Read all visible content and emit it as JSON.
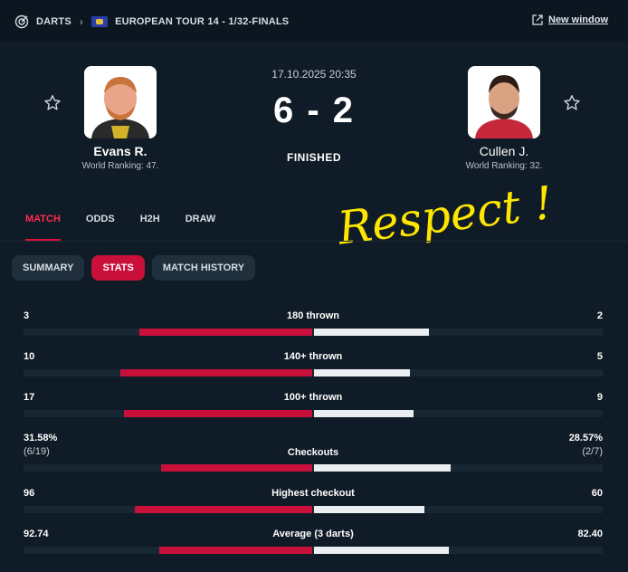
{
  "breadcrumb": {
    "sport": "DARTS",
    "tournament": "EUROPEAN TOUR 14 - 1/32-FINALS"
  },
  "new_window": "New window",
  "match": {
    "datetime": "17.10.2025 20:35",
    "score": "6 - 2",
    "status": "FINISHED"
  },
  "home": {
    "name": "Evans R.",
    "ranking": "World Ranking: 47."
  },
  "away": {
    "name": "Cullen J.",
    "ranking": "World Ranking: 32."
  },
  "tabs": [
    "MATCH",
    "ODDS",
    "H2H",
    "DRAW"
  ],
  "subtabs": [
    "SUMMARY",
    "STATS",
    "MATCH HISTORY"
  ],
  "annotation": "Respect !",
  "stats": [
    {
      "label": "180 thrown",
      "home": "3",
      "away": "2",
      "home_frac": 0.6,
      "away_frac": 0.4
    },
    {
      "label": "140+ thrown",
      "home": "10",
      "away": "5",
      "home_frac": 0.667,
      "away_frac": 0.333
    },
    {
      "label": "100+ thrown",
      "home": "17",
      "away": "9",
      "home_frac": 0.654,
      "away_frac": 0.346
    },
    {
      "label": "Checkouts",
      "home": "31.58%",
      "away": "28.57%",
      "home_sub": "(6/19)",
      "away_sub": "(2/7)",
      "home_frac": 0.525,
      "away_frac": 0.475
    },
    {
      "label": "Highest checkout",
      "home": "96",
      "away": "60",
      "home_frac": 0.615,
      "away_frac": 0.385
    },
    {
      "label": "Average (3 darts)",
      "home": "92.74",
      "away": "82.40",
      "home_frac": 0.53,
      "away_frac": 0.47
    }
  ],
  "colors": {
    "accent": "#c8103a",
    "background": "#0f1b26",
    "bar_away": "#eaeef1"
  }
}
